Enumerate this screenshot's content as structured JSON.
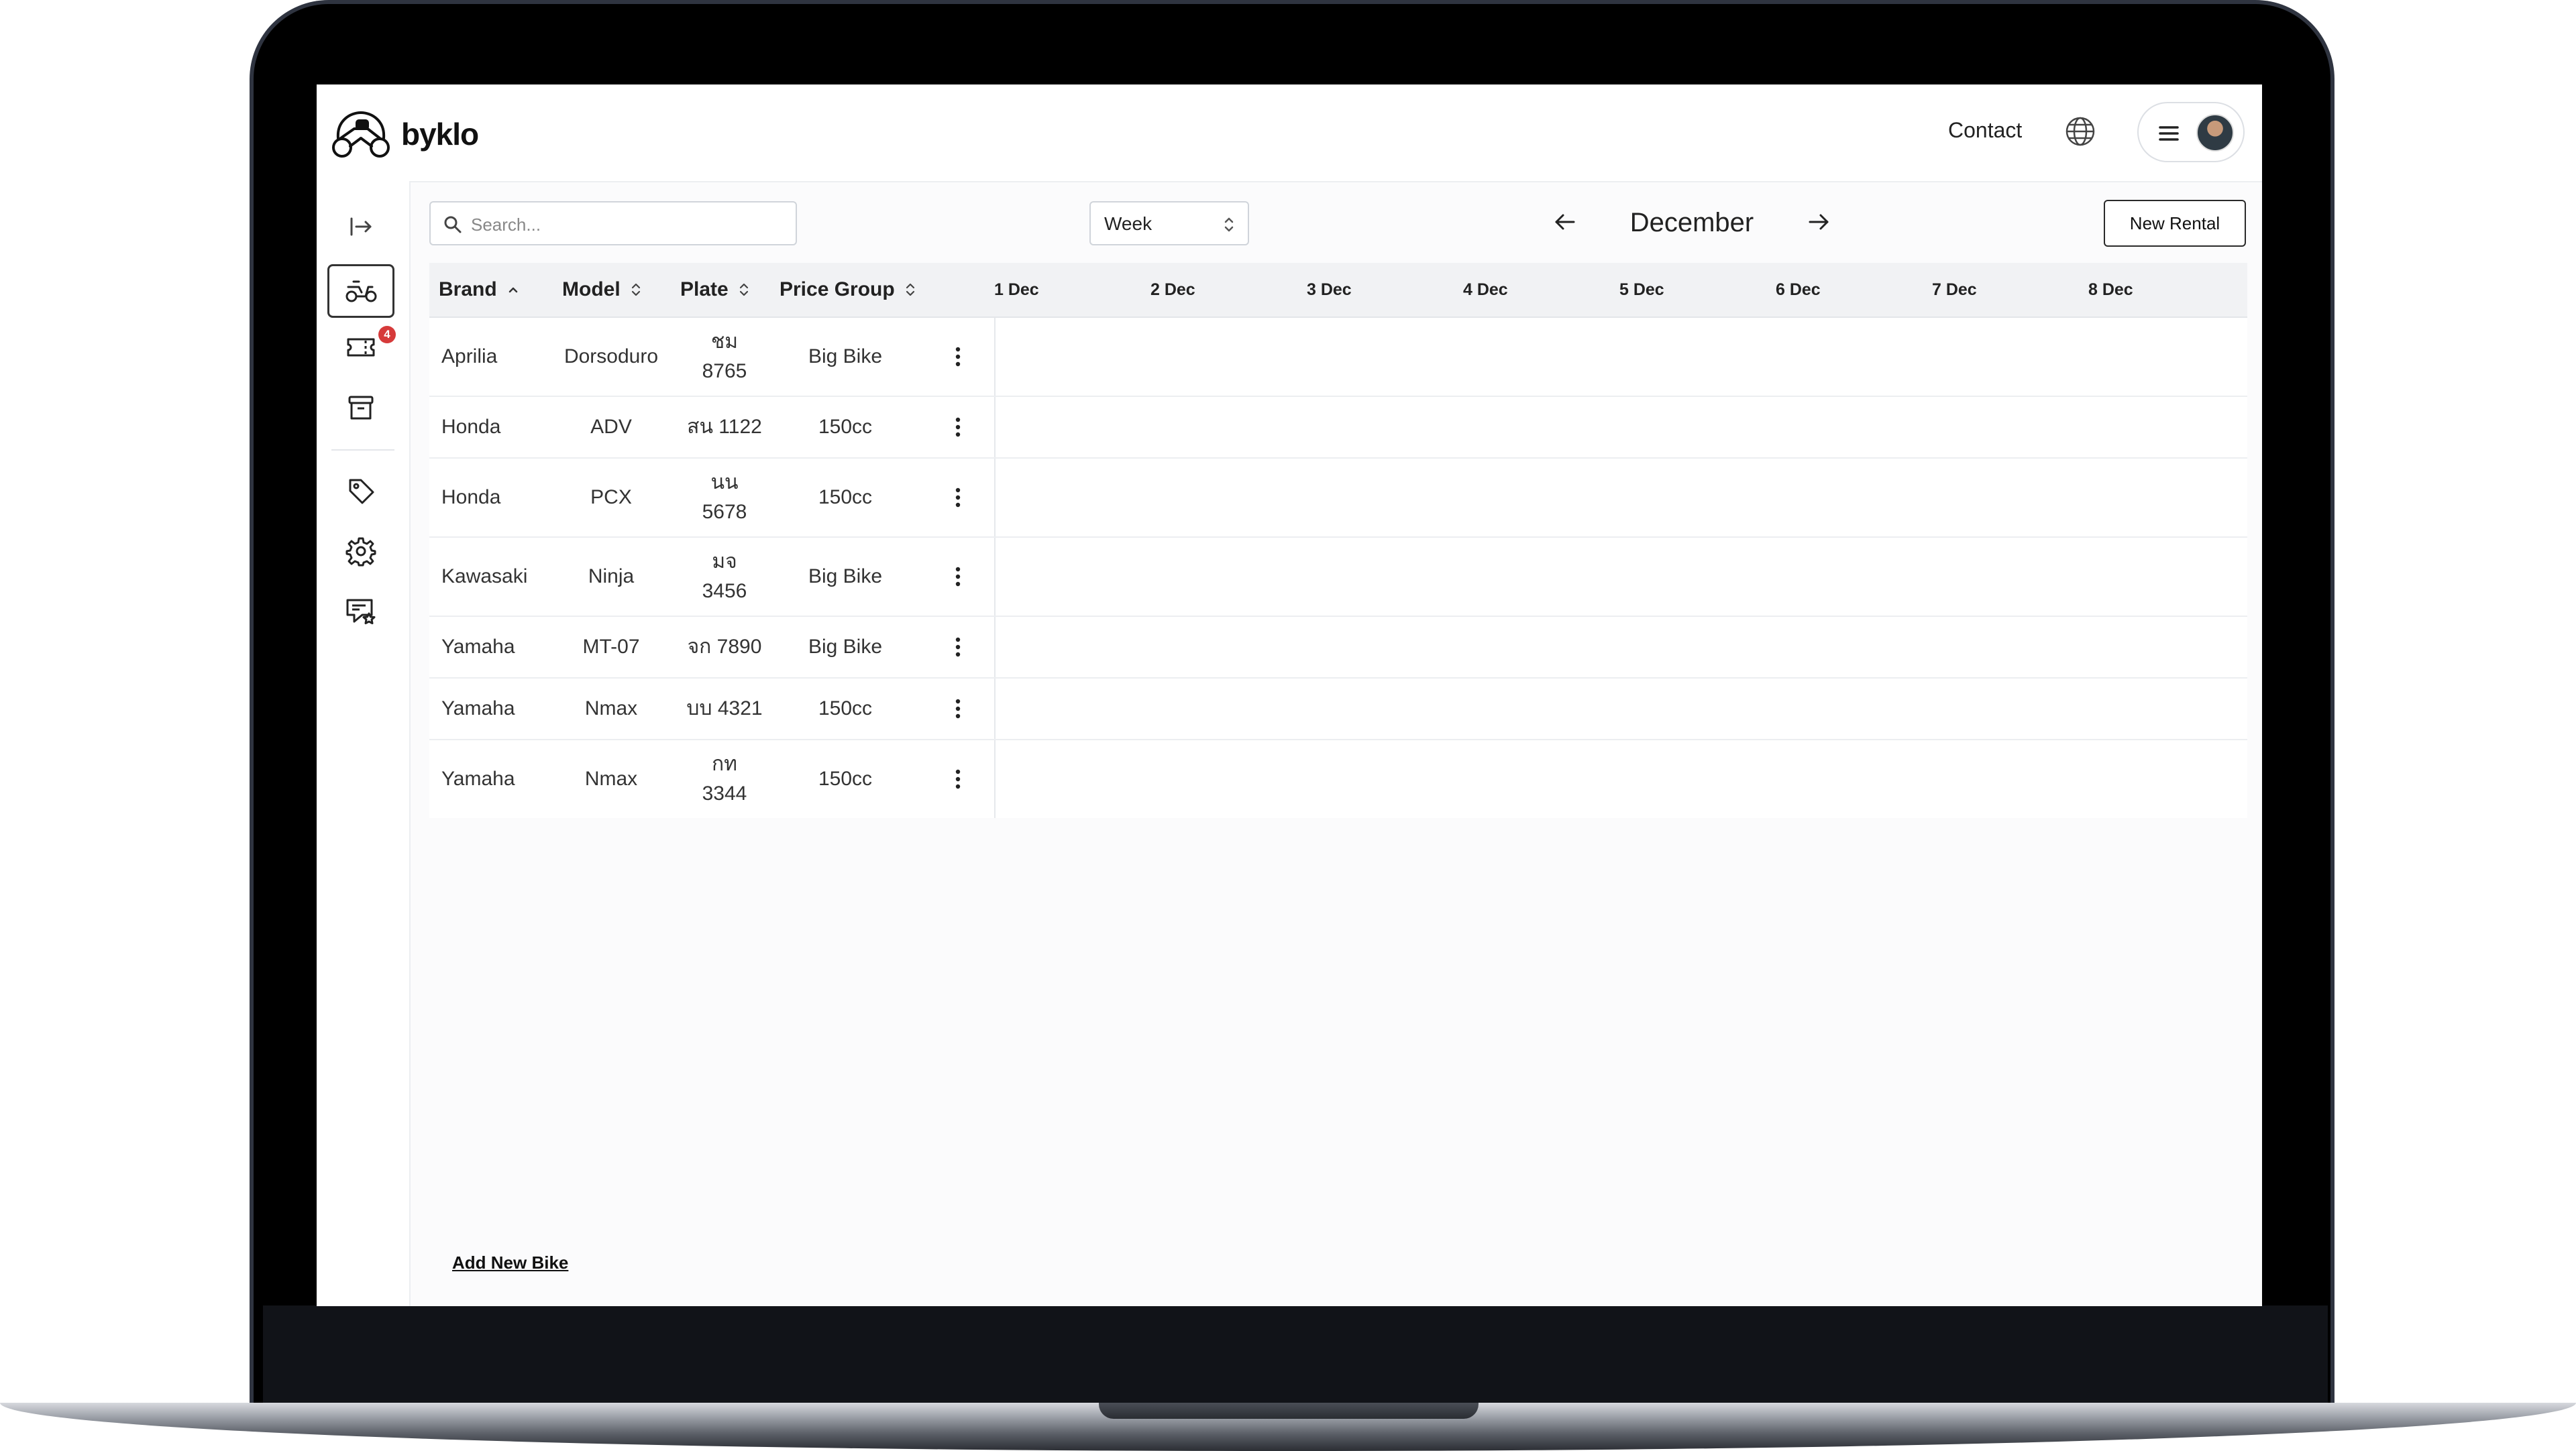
{
  "app": {
    "name": "byklo"
  },
  "header": {
    "contact_label": "Contact"
  },
  "sidebar": {
    "items": [
      {
        "icon": "expand-sidebar-icon"
      },
      {
        "icon": "scooter-icon",
        "active": true
      },
      {
        "icon": "ticket-icon",
        "badge": "4"
      },
      {
        "icon": "archive-icon"
      },
      {
        "icon": "tag-icon"
      },
      {
        "icon": "gear-icon"
      },
      {
        "icon": "review-star-icon"
      }
    ]
  },
  "toolbar": {
    "search_placeholder": "Search...",
    "view_select": "Week",
    "month": "December",
    "new_rental_label": "New Rental"
  },
  "table": {
    "columns": [
      "Brand",
      "Model",
      "Plate",
      "Price Group"
    ],
    "days": [
      "1 Dec",
      "2 Dec",
      "3 Dec",
      "4 Dec",
      "5 Dec",
      "6 Dec",
      "7 Dec",
      "8 Dec"
    ],
    "rows": [
      {
        "brand": "Aprilia",
        "model": "Dorsoduro",
        "plate_prefix": "ชม",
        "plate_num": "8765",
        "price_group": "Big Bike"
      },
      {
        "brand": "Honda",
        "model": "ADV",
        "plate_prefix": "สน 1122",
        "plate_num": "",
        "price_group": "150cc"
      },
      {
        "brand": "Honda",
        "model": "PCX",
        "plate_prefix": "นน",
        "plate_num": "5678",
        "price_group": "150cc"
      },
      {
        "brand": "Kawasaki",
        "model": "Ninja",
        "plate_prefix": "มจ",
        "plate_num": "3456",
        "price_group": "Big Bike"
      },
      {
        "brand": "Yamaha",
        "model": "MT-07",
        "plate_prefix": "จก 7890",
        "plate_num": "",
        "price_group": "Big Bike"
      },
      {
        "brand": "Yamaha",
        "model": "Nmax",
        "plate_prefix": "บบ 4321",
        "plate_num": "",
        "price_group": "150cc"
      },
      {
        "brand": "Yamaha",
        "model": "Nmax",
        "plate_prefix": "กท",
        "plate_num": "3344",
        "price_group": "150cc"
      }
    ]
  },
  "footer": {
    "add_bike_label": "Add New Bike"
  }
}
